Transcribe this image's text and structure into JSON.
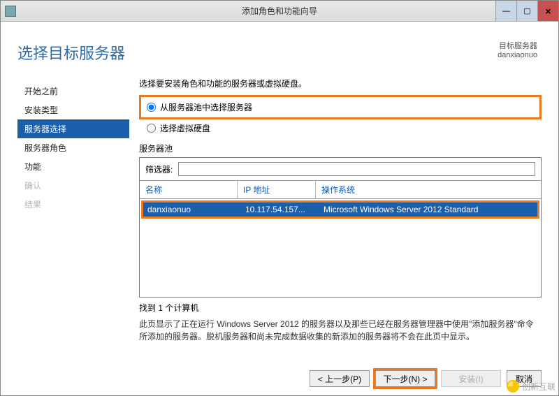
{
  "window": {
    "title": "添加角色和功能向导"
  },
  "header": {
    "page_title": "选择目标服务器",
    "topright_label": "目标服务器",
    "topright_server": "danxiaonuo"
  },
  "nav": {
    "items": [
      {
        "label": "开始之前",
        "state": "normal"
      },
      {
        "label": "安装类型",
        "state": "normal"
      },
      {
        "label": "服务器选择",
        "state": "selected"
      },
      {
        "label": "服务器角色",
        "state": "normal"
      },
      {
        "label": "功能",
        "state": "normal"
      },
      {
        "label": "确认",
        "state": "disabled"
      },
      {
        "label": "结果",
        "state": "disabled"
      }
    ]
  },
  "main": {
    "instruction": "选择要安装角色和功能的服务器或虚拟硬盘。",
    "radio1": "从服务器池中选择服务器",
    "radio2": "选择虚拟硬盘",
    "pool_label": "服务器池",
    "filter_label": "筛选器:",
    "filter_value": "",
    "columns": {
      "name": "名称",
      "ip": "IP 地址",
      "os": "操作系统"
    },
    "rows": [
      {
        "name": "danxiaonuo",
        "ip": "10.117.54.157...",
        "os": "Microsoft Windows Server 2012 Standard"
      }
    ],
    "status_line": "找到 1 个计算机",
    "footnote": "此页显示了正在运行 Windows Server 2012 的服务器以及那些已经在服务器管理器中使用\"添加服务器\"命令所添加的服务器。脱机服务器和尚未完成数据收集的新添加的服务器将不会在此页中显示。"
  },
  "footer": {
    "prev": "< 上一步(P)",
    "next": "下一步(N) >",
    "install": "安装(I)",
    "cancel": "取消"
  },
  "watermark": "创新互联"
}
